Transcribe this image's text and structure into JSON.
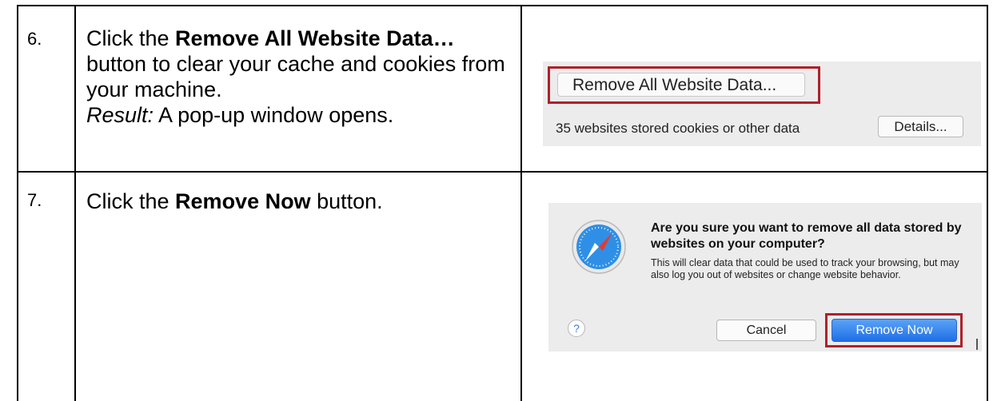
{
  "steps": [
    {
      "number": "6.",
      "text": {
        "prefix": "Click the ",
        "bold": "Remove All Website Data…",
        "suffix": " button to clear your cache and cookies from your machine.",
        "result_label": "Result:",
        "result_text": " A pop-up window opens."
      },
      "screenshot": {
        "remove_button": "Remove All Website Data...",
        "stored_text": "35 websites stored cookies or other data",
        "details_button": "Details..."
      }
    },
    {
      "number": "7.",
      "text": {
        "prefix": "Click the ",
        "bold": "Remove Now",
        "suffix": " button."
      },
      "screenshot": {
        "icon": "safari-compass-icon",
        "title": "Are you sure you want to remove all data stored by websites on your computer?",
        "body": "This will clear data that could be used to track your browsing, but may also log you out of websites or change website behavior.",
        "help_glyph": "?",
        "cancel_button": "Cancel",
        "remove_now_button": "Remove Now"
      }
    }
  ],
  "colors": {
    "highlight_border": "#b0202a",
    "primary_button": "#2a7be8",
    "dialog_background": "#ececec"
  }
}
